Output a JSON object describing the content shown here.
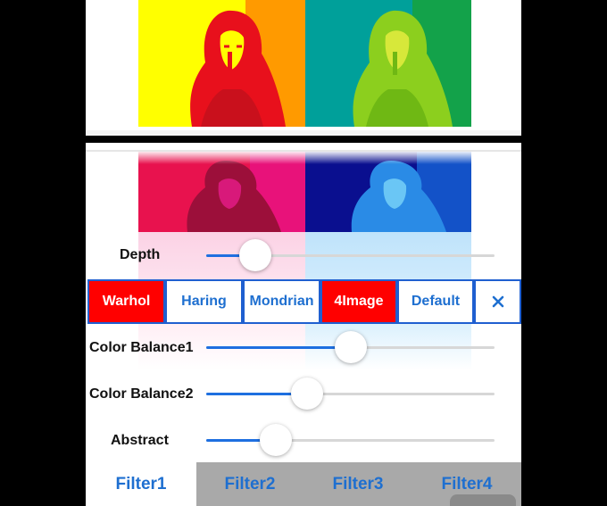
{
  "controls": {
    "depth": {
      "label": "Depth",
      "value": 0.17
    },
    "color_balance1": {
      "label": "Color Balance1",
      "value": 0.5
    },
    "color_balance2": {
      "label": "Color Balance2",
      "value": 0.35
    },
    "abstract": {
      "label": "Abstract",
      "value": 0.24
    }
  },
  "styles": {
    "buttons": [
      {
        "label": "Warhol",
        "active": true
      },
      {
        "label": "Haring",
        "active": false
      },
      {
        "label": "Mondrian",
        "active": false
      },
      {
        "label": "4Image",
        "active": true
      },
      {
        "label": "Default",
        "active": false
      }
    ],
    "close_icon": "close-icon"
  },
  "tabs": [
    {
      "label": "Filter1",
      "selected": true
    },
    {
      "label": "Filter2",
      "selected": false
    },
    {
      "label": "Filter3",
      "selected": false
    },
    {
      "label": "Filter4",
      "selected": false
    }
  ],
  "colors": {
    "accent": "#1e6fd0",
    "active_button": "#ff0000",
    "slider_fill": "#1e6fe0",
    "tabbar_background": "#a9a9a9"
  }
}
